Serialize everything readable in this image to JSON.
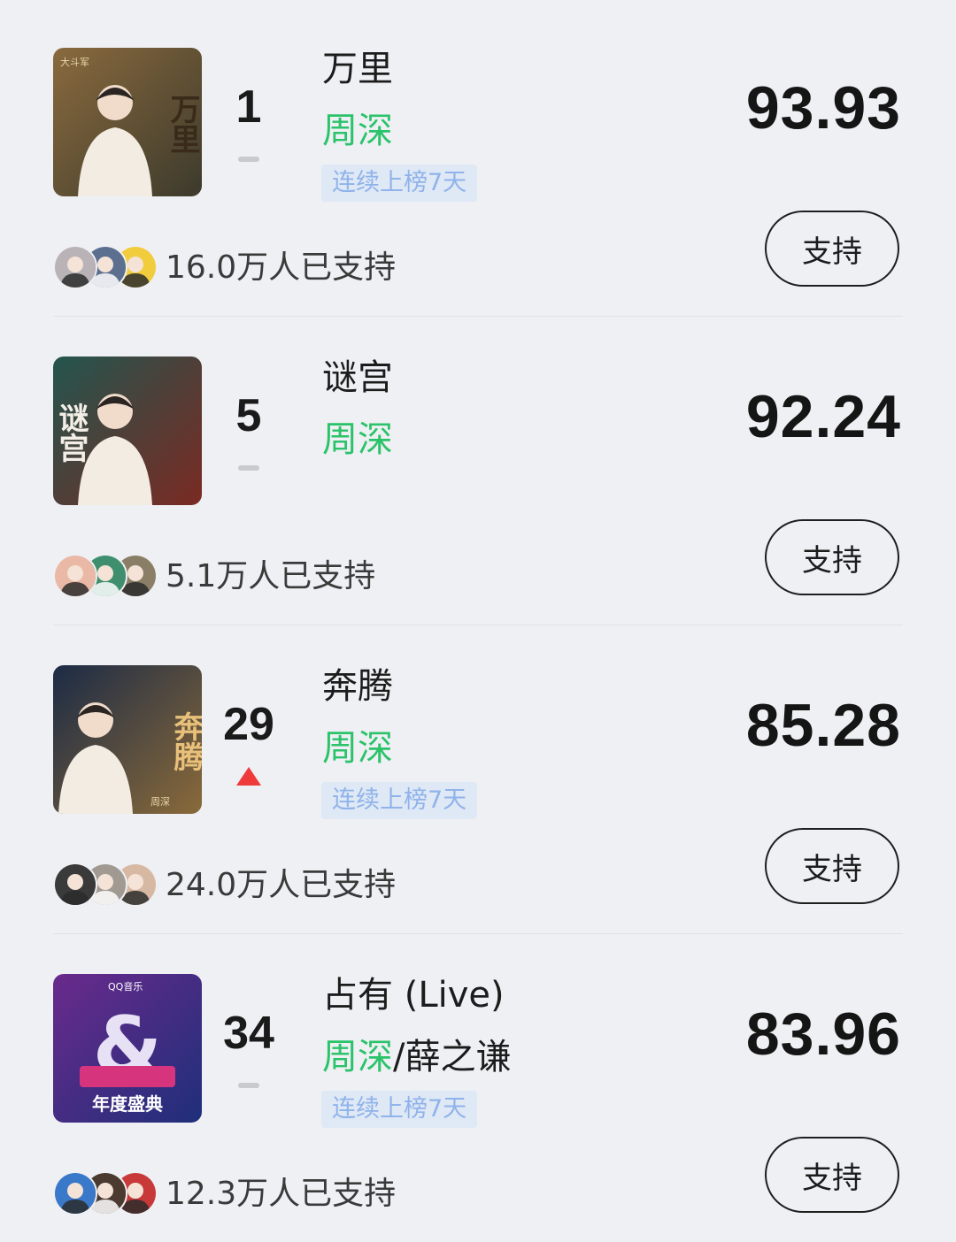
{
  "chart": {
    "entries": [
      {
        "rank": "1",
        "trend": "flat",
        "title": "万里",
        "artist_main": "周深",
        "artist_rest": "",
        "streak": "连续上榜7天",
        "score": "93.93",
        "support_label": "支持",
        "supporters": "16.0万人已支持",
        "cover": {
          "text": "万里",
          "side_text": "大斗军",
          "colors": [
            "#8a6a3e",
            "#3c3a2c"
          ],
          "text_color": "#3a2a1a"
        },
        "avatar_colors": [
          "#b9b2b6",
          "#5c6f8f",
          "#f1cc3d"
        ]
      },
      {
        "rank": "5",
        "trend": "flat",
        "title": "谜宫",
        "artist_main": "周深",
        "artist_rest": "",
        "streak": "",
        "score": "92.24",
        "support_label": "支持",
        "supporters": "5.1万人已支持",
        "cover": {
          "text": "谜宫",
          "side_text": "",
          "colors": [
            "#23554e",
            "#7a2a22"
          ],
          "text_color": "#f4efe6"
        },
        "avatar_colors": [
          "#e9b9a6",
          "#3f8f6f",
          "#8a7f66"
        ]
      },
      {
        "rank": "29",
        "trend": "up",
        "title": "奔腾",
        "artist_main": "周深",
        "artist_rest": "",
        "streak": "连续上榜7天",
        "score": "85.28",
        "support_label": "支持",
        "supporters": "24.0万人已支持",
        "cover": {
          "text": "奔腾",
          "side_text": "周深",
          "colors": [
            "#1c2b45",
            "#8a6a3a"
          ],
          "text_color": "#e8c07a"
        },
        "avatar_colors": [
          "#3a3a3a",
          "#a09a92",
          "#d7b9a3"
        ]
      },
      {
        "rank": "34",
        "trend": "flat",
        "title": "占有 (Live)",
        "artist_main": "周深",
        "artist_rest": "/薛之谦",
        "streak": "连续上榜7天",
        "score": "83.96",
        "support_label": "支持",
        "supporters": "12.3万人已支持",
        "cover": {
          "text": "年度盛典",
          "side_text": "QQ音乐",
          "colors": [
            "#6a2a8c",
            "#1f2f7a"
          ],
          "text_color": "#ffffff"
        },
        "avatar_colors": [
          "#3a78c9",
          "#4a3a30",
          "#c83a3a"
        ]
      }
    ]
  }
}
